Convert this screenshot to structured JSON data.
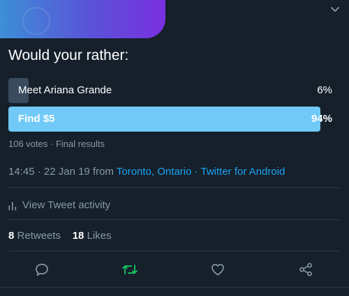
{
  "tweet": {
    "question": "Would your rather:",
    "poll": {
      "options": [
        {
          "label": "Meet Ariana Grande",
          "percent_text": "6%",
          "percent": 6
        },
        {
          "label": "Find $5",
          "percent_text": "94%",
          "percent": 94
        }
      ],
      "votes_text": "106 votes",
      "status_text": "Final results"
    },
    "time": "14:45",
    "date": "22 Jan 19",
    "from_text": "from",
    "location": "Toronto, Ontario",
    "source": "Twitter for Android",
    "view_activity_label": "View Tweet activity",
    "retweets_count": "8",
    "retweets_label": "Retweets",
    "likes_count": "18",
    "likes_label": "Likes"
  },
  "icons": {
    "reply": "comment-icon",
    "retweet": "retweet-icon",
    "like": "heart-icon",
    "share": "share-icon",
    "activity": "bar-chart-icon",
    "menu": "chevron-down-icon"
  },
  "colors": {
    "background": "#15202b",
    "accent": "#1da1f2",
    "winning_bar": "#71c9f8",
    "losing_bar": "#3a4b5e",
    "retweet_active": "#17bf63",
    "muted": "#8899a6"
  }
}
